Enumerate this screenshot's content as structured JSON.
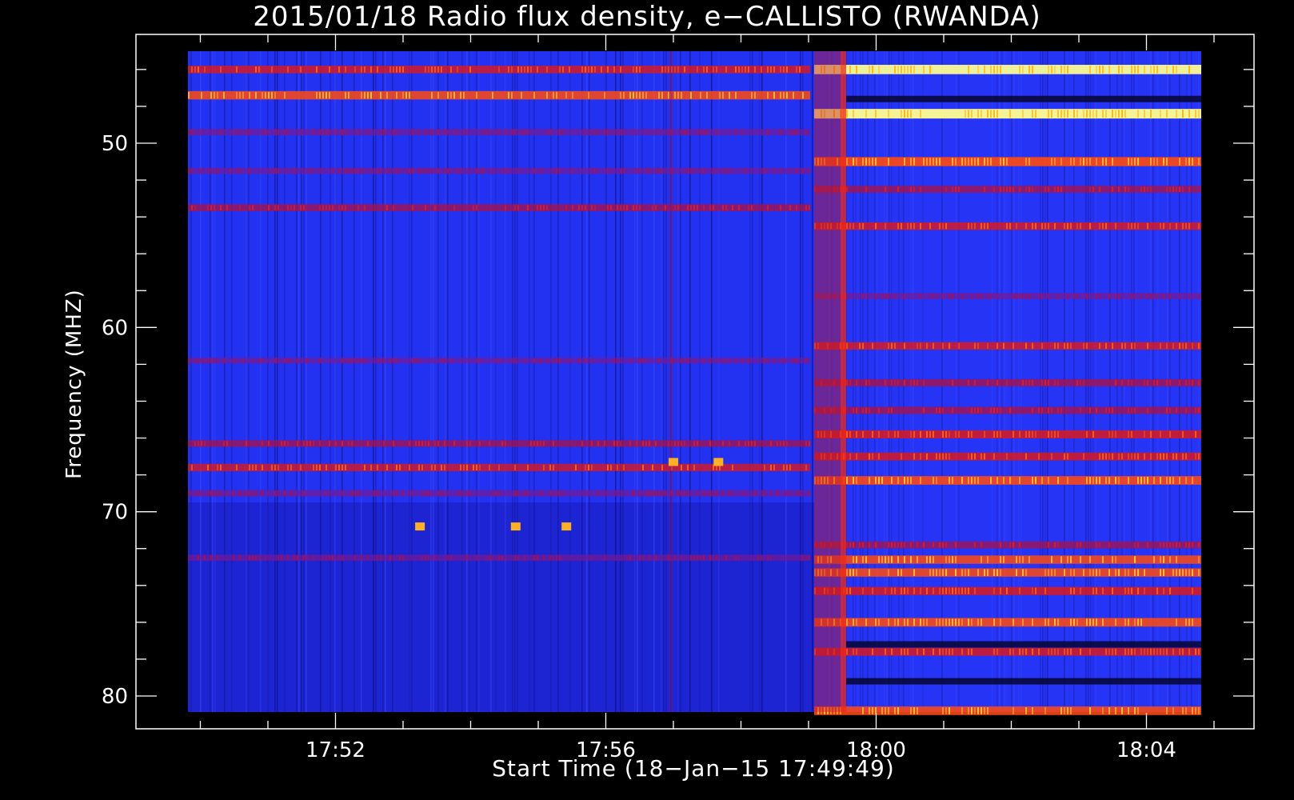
{
  "chart_data": {
    "type": "heatmap",
    "title": "2015/01/18  Radio flux density, e−CALLISTO (RWANDA)",
    "xlabel": "Start Time (18−Jan−15 17:49:49)",
    "ylabel": "Frequency (MHZ)",
    "x_ticks": [
      "17:52",
      "17:56",
      "18:00",
      "18:04"
    ],
    "x_start": "17:49:49",
    "x_end": "18:04:49",
    "y_ticks": [
      50,
      60,
      70,
      80
    ],
    "ylim": [
      45,
      81
    ],
    "y_inverted": true,
    "colormap": [
      "#000000",
      "#1a1adc",
      "#2040ff",
      "#b01030",
      "#ff2000",
      "#ffa000",
      "#ffff80"
    ],
    "burst_time": "17:59:05",
    "bands_before": [
      {
        "freq": 46.0,
        "intensity": 0.6
      },
      {
        "freq": 47.4,
        "intensity": 0.75
      },
      {
        "freq": 49.4,
        "intensity": 0.35
      },
      {
        "freq": 51.5,
        "intensity": 0.3
      },
      {
        "freq": 53.5,
        "intensity": 0.45
      },
      {
        "freq": 61.8,
        "intensity": 0.25
      },
      {
        "freq": 66.3,
        "intensity": 0.4
      },
      {
        "freq": 67.6,
        "intensity": 0.55
      },
      {
        "freq": 69.0,
        "intensity": 0.35
      },
      {
        "freq": 72.5,
        "intensity": 0.3
      }
    ],
    "bands_after": [
      {
        "freq": 46.0,
        "intensity": 0.95
      },
      {
        "freq": 48.4,
        "intensity": 1.0
      },
      {
        "freq": 51.0,
        "intensity": 0.9
      },
      {
        "freq": 52.5,
        "intensity": 0.45
      },
      {
        "freq": 54.5,
        "intensity": 0.6
      },
      {
        "freq": 58.3,
        "intensity": 0.3
      },
      {
        "freq": 61.0,
        "intensity": 0.6
      },
      {
        "freq": 63.0,
        "intensity": 0.5
      },
      {
        "freq": 64.5,
        "intensity": 0.5
      },
      {
        "freq": 65.8,
        "intensity": 0.7
      },
      {
        "freq": 67.0,
        "intensity": 0.65
      },
      {
        "freq": 68.3,
        "intensity": 0.8
      },
      {
        "freq": 71.8,
        "intensity": 0.45
      },
      {
        "freq": 72.6,
        "intensity": 0.75
      },
      {
        "freq": 73.3,
        "intensity": 0.75
      },
      {
        "freq": 74.3,
        "intensity": 0.7
      },
      {
        "freq": 76.0,
        "intensity": 0.8
      },
      {
        "freq": 77.6,
        "intensity": 0.65
      },
      {
        "freq": 80.8,
        "intensity": 0.8
      }
    ],
    "spikes": [
      {
        "time": "17:53:15",
        "freq": 70.8
      },
      {
        "time": "17:54:40",
        "freq": 70.8
      },
      {
        "time": "17:55:25",
        "freq": 70.8
      },
      {
        "time": "17:57:40",
        "freq": 67.3
      },
      {
        "time": "17:57:00",
        "freq": 67.3
      }
    ]
  }
}
